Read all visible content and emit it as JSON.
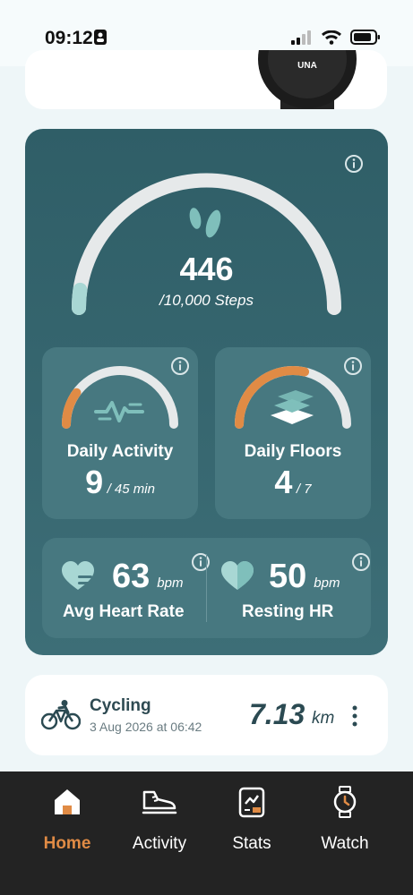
{
  "status_bar": {
    "time": "09:12"
  },
  "steps": {
    "value": "446",
    "goal": "/10,000 Steps",
    "progress": 0.045
  },
  "daily_activity": {
    "title": "Daily Activity",
    "value": "9",
    "goal": "/ 45 min",
    "progress": 0.2
  },
  "daily_floors": {
    "title": "Daily Floors",
    "value": "4",
    "goal": "/ 7",
    "progress": 0.57
  },
  "heart": {
    "avg_value": "63",
    "avg_unit": "bpm",
    "avg_label": "Avg Heart Rate",
    "rest_value": "50",
    "rest_unit": "bpm",
    "rest_label": "Resting HR"
  },
  "activity": {
    "title": "Cycling",
    "date": "3 Aug 2026 at 06:42",
    "value": "7.13",
    "unit": "km"
  },
  "nav": {
    "home": "Home",
    "activity": "Activity",
    "stats": "Stats",
    "watch": "Watch"
  },
  "watch_brand": "UNA",
  "colors": {
    "accent": "#e08b45",
    "teal_card": "#2f5e67",
    "gauge_track": "#e6e9ea",
    "gauge_fill": "#a8d7d4"
  }
}
